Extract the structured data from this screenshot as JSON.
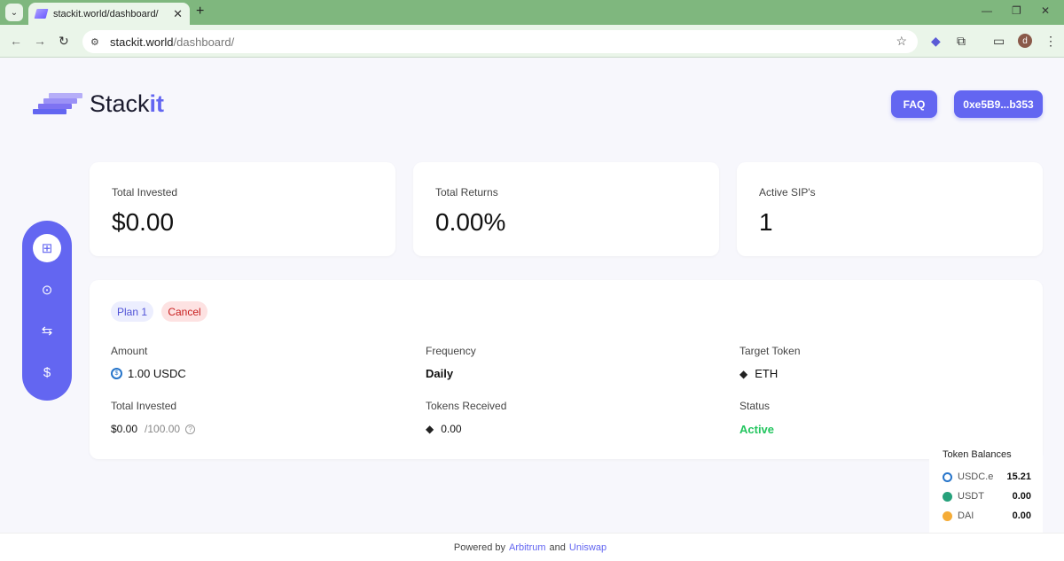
{
  "browser": {
    "tab_title": "stackit.world/dashboard/",
    "url_host": "stackit.world",
    "url_path": "/dashboard/",
    "profile_initial": "d"
  },
  "header": {
    "brand_prefix": "Stack",
    "brand_suffix": "it",
    "faq_label": "FAQ",
    "wallet_label": "0xe5B9...b353"
  },
  "stats": [
    {
      "label": "Total Invested",
      "value": "$0.00"
    },
    {
      "label": "Total Returns",
      "value": "0.00%"
    },
    {
      "label": "Active SIP's",
      "value": "1"
    }
  ],
  "plan": {
    "name": "Plan 1",
    "cancel_label": "Cancel",
    "amount_label": "Amount",
    "amount_value": "1.00 USDC",
    "frequency_label": "Frequency",
    "frequency_value": "Daily",
    "target_label": "Target Token",
    "target_value": "ETH",
    "invested_label": "Total Invested",
    "invested_value": "$0.00",
    "invested_cap": "/100.00",
    "received_label": "Tokens Received",
    "received_value": "0.00",
    "status_label": "Status",
    "status_value": "Active"
  },
  "token_balances": {
    "title": "Token Balances",
    "rows": [
      {
        "name": "USDC.e",
        "amount": "15.21",
        "color": "#2775ca"
      },
      {
        "name": "USDT",
        "amount": "0.00",
        "color": "#26a17b"
      },
      {
        "name": "DAI",
        "amount": "0.00",
        "color": "#f5ac37"
      }
    ]
  },
  "footer": {
    "prefix": "Powered by",
    "link1": "Arbitrum",
    "and": "and",
    "link2": "Uniswap"
  },
  "colors": {
    "accent": "#6366f1",
    "active": "#22c55e",
    "cancel_bg": "#fde2e2",
    "cancel_text": "#c81e1e",
    "plan_bg": "#eceefe"
  }
}
